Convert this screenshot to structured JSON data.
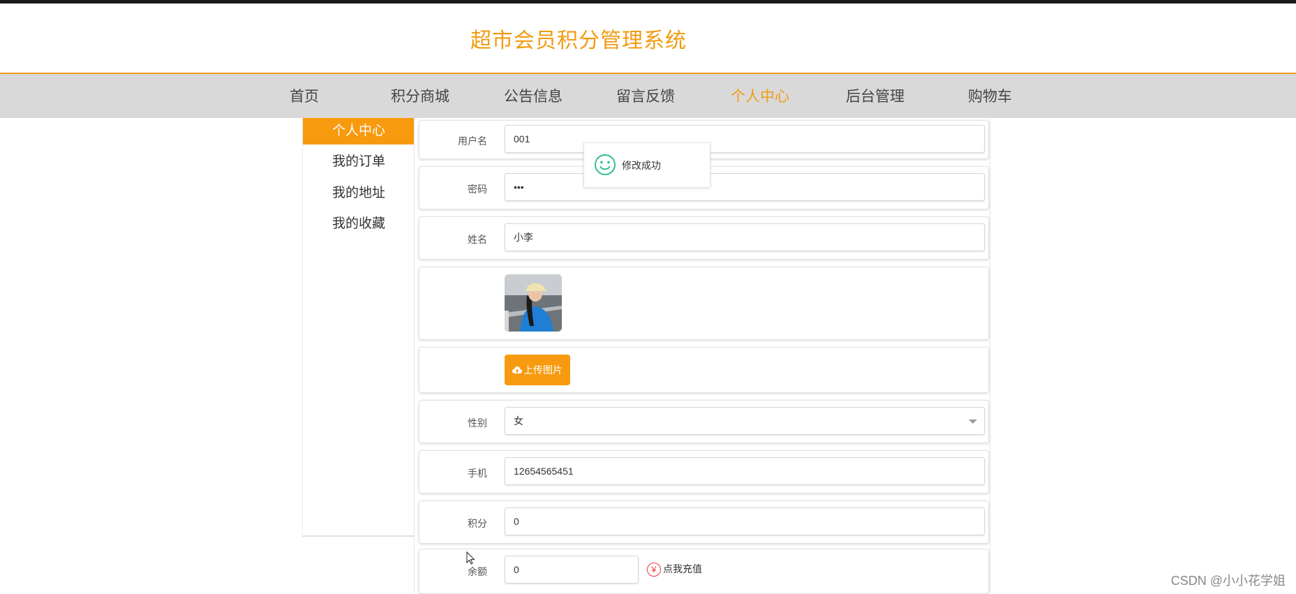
{
  "header": {
    "title": "超市会员积分管理系统"
  },
  "nav": {
    "items": [
      "首页",
      "积分商城",
      "公告信息",
      "留言反馈",
      "个人中心",
      "后台管理",
      "购物车"
    ],
    "active": "个人中心"
  },
  "sidebar": {
    "items": [
      "个人中心",
      "我的订单",
      "我的地址",
      "我的收藏"
    ],
    "active": "个人中心"
  },
  "form": {
    "username": {
      "label": "用户名",
      "value": "001"
    },
    "password": {
      "label": "密码",
      "value": "•••"
    },
    "name": {
      "label": "姓名",
      "value": "小李"
    },
    "upload_button": "上传图片",
    "gender": {
      "label": "性别",
      "value": "女"
    },
    "phone": {
      "label": "手机",
      "value": "12654565451"
    },
    "points": {
      "label": "积分",
      "value": "0"
    },
    "balance": {
      "label": "余额",
      "value": "0"
    },
    "recharge_link": "点我充值"
  },
  "toast": {
    "message": "修改成功"
  },
  "watermark": "CSDN @小小花学姐",
  "colors": {
    "accent": "#f79a0e",
    "nav_bg": "#d9d9d9",
    "success_icon": "#2fbf8f"
  }
}
